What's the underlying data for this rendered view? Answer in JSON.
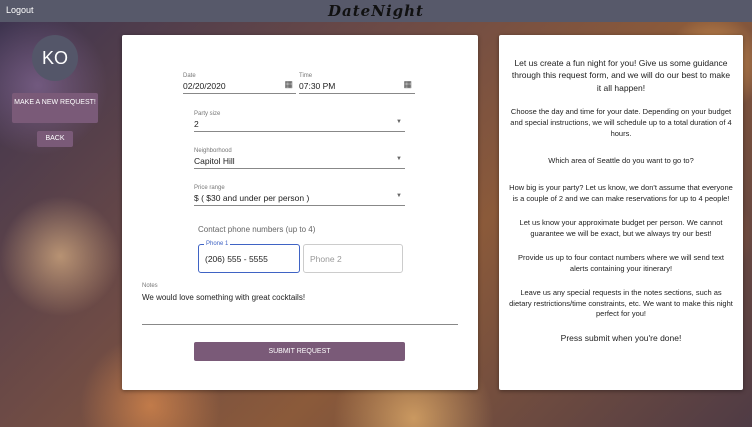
{
  "nav": {
    "logout": "Logout",
    "brand": "DateNight"
  },
  "sidebar": {
    "avatar_initials": "KO",
    "new_request": "MAKE A NEW REQUEST!",
    "back": "BACK"
  },
  "form": {
    "date": {
      "label": "Date",
      "value": "02/20/2020",
      "icon": "calendar-icon"
    },
    "time": {
      "label": "Time",
      "value": "07:30 PM",
      "icon": "calendar-icon"
    },
    "party_size": {
      "label": "Party size",
      "value": "2"
    },
    "neighborhood": {
      "label": "Neighborhood",
      "value": "Capitol Hill"
    },
    "price_range": {
      "label": "Price range",
      "value": "$ ( $30 and under per person )"
    },
    "contact_label": "Contact phone numbers (up to 4)",
    "phone1": {
      "label": "Phone 1",
      "value": "(206) 555 - 5555"
    },
    "phone2": {
      "placeholder": "Phone 2"
    },
    "notes": {
      "label": "Notes",
      "value": "We would love something with great cocktails!"
    },
    "submit": "SUBMIT REQUEST"
  },
  "help": [
    "Let us create a fun night for you! Give us some guidance through this request form, and we will do our best to make it all happen!",
    "Choose the day and time for your date. Depending on your budget and special instructions, we will schedule up to a total duration of 4 hours.",
    "Which area of Seattle do you want to go to?",
    "How big is your party? Let us know, we don't assume that everyone is a couple of 2 and we can make reservations for up to 4 people!",
    "Let us know your approximate budget per person. We cannot guarantee we will be exact, but we always try our best!",
    "Provide us up to four contact numbers where we will send text alerts containing your itinerary!",
    "Leave us any special requests in the notes sections, such as dietary restrictions/time constraints, etc. We want to make this night perfect for you!",
    "Press submit when you're done!"
  ]
}
